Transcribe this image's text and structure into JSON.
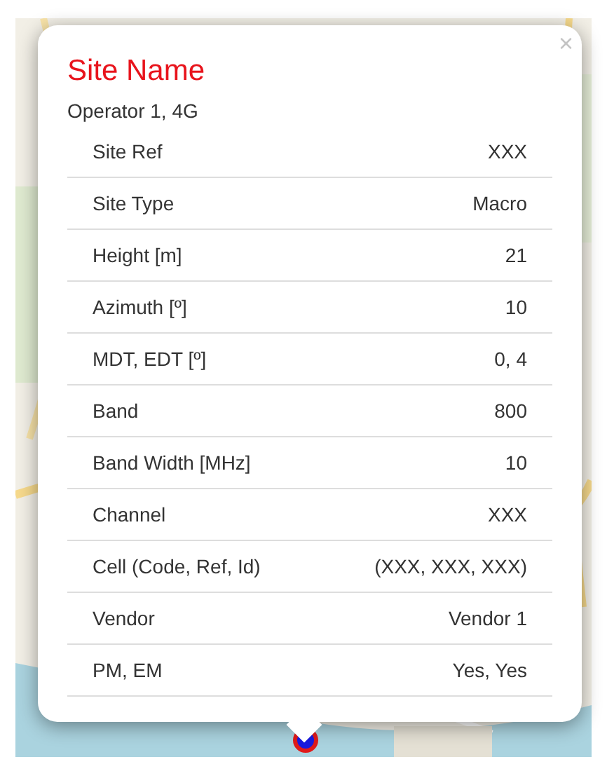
{
  "popup": {
    "close": "×",
    "title": "Site Name",
    "subtitle": "Operator 1, 4G",
    "rows": [
      {
        "label": "Site Ref",
        "value": "XXX"
      },
      {
        "label": "Site Type",
        "value": "Macro"
      },
      {
        "label": "Height [m]",
        "value": "21"
      },
      {
        "label": "Azimuth [º]",
        "value": "10"
      },
      {
        "label": "MDT, EDT [º]",
        "value": "0, 4"
      },
      {
        "label": "Band",
        "value": "800"
      },
      {
        "label": "Band Width [MHz]",
        "value": "10"
      },
      {
        "label": "Channel",
        "value": "XXX"
      },
      {
        "label": "Cell (Code, Ref, Id)",
        "value": "(XXX, XXX, XXX)"
      },
      {
        "label": "Vendor",
        "value": "Vendor 1"
      },
      {
        "label": "PM, EM",
        "value": "Yes, Yes"
      }
    ]
  }
}
